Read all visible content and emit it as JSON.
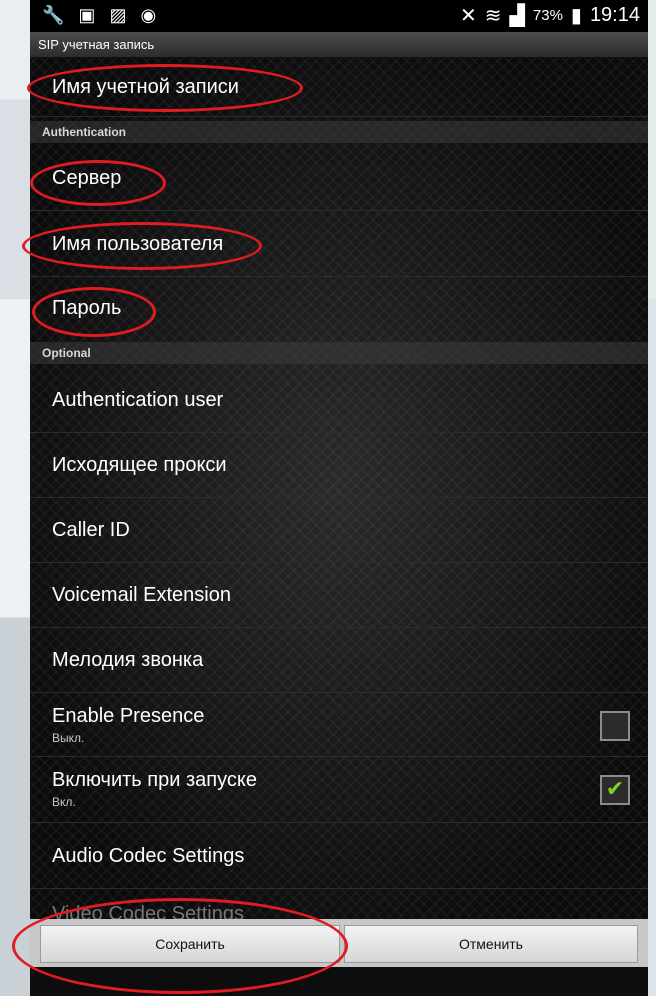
{
  "statusbar": {
    "left_icons": [
      "wrench-icon",
      "no-sim-icon",
      "image-icon",
      "shield-icon"
    ],
    "battery_percent": "73%",
    "time": "19:14"
  },
  "titlebar": {
    "title": "SIP учетная запись"
  },
  "list": {
    "account_name": "Имя учетной записи",
    "section_authentication": "Authentication",
    "server": "Сервер",
    "username": "Имя пользователя",
    "password": "Пароль",
    "section_optional": "Optional",
    "auth_user": "Authentication user",
    "outbound_proxy": "Исходящее прокси",
    "caller_id": "Caller ID",
    "voicemail_extension": "Voicemail Extension",
    "ringtone": "Мелодия звонка",
    "enable_presence": {
      "label": "Enable Presence",
      "summary": "Выкл.",
      "checked": false
    },
    "enable_on_startup": {
      "label": "Включить при запуске",
      "summary": "Вкл.",
      "checked": true
    },
    "audio_codec_settings": "Audio Codec Settings",
    "video_codec_settings_partial": "Video Codec Settings"
  },
  "buttons": {
    "save": "Сохранить",
    "cancel": "Отменить"
  },
  "colors": {
    "annotation": "#e01b22",
    "checkmark": "#7ed321"
  }
}
